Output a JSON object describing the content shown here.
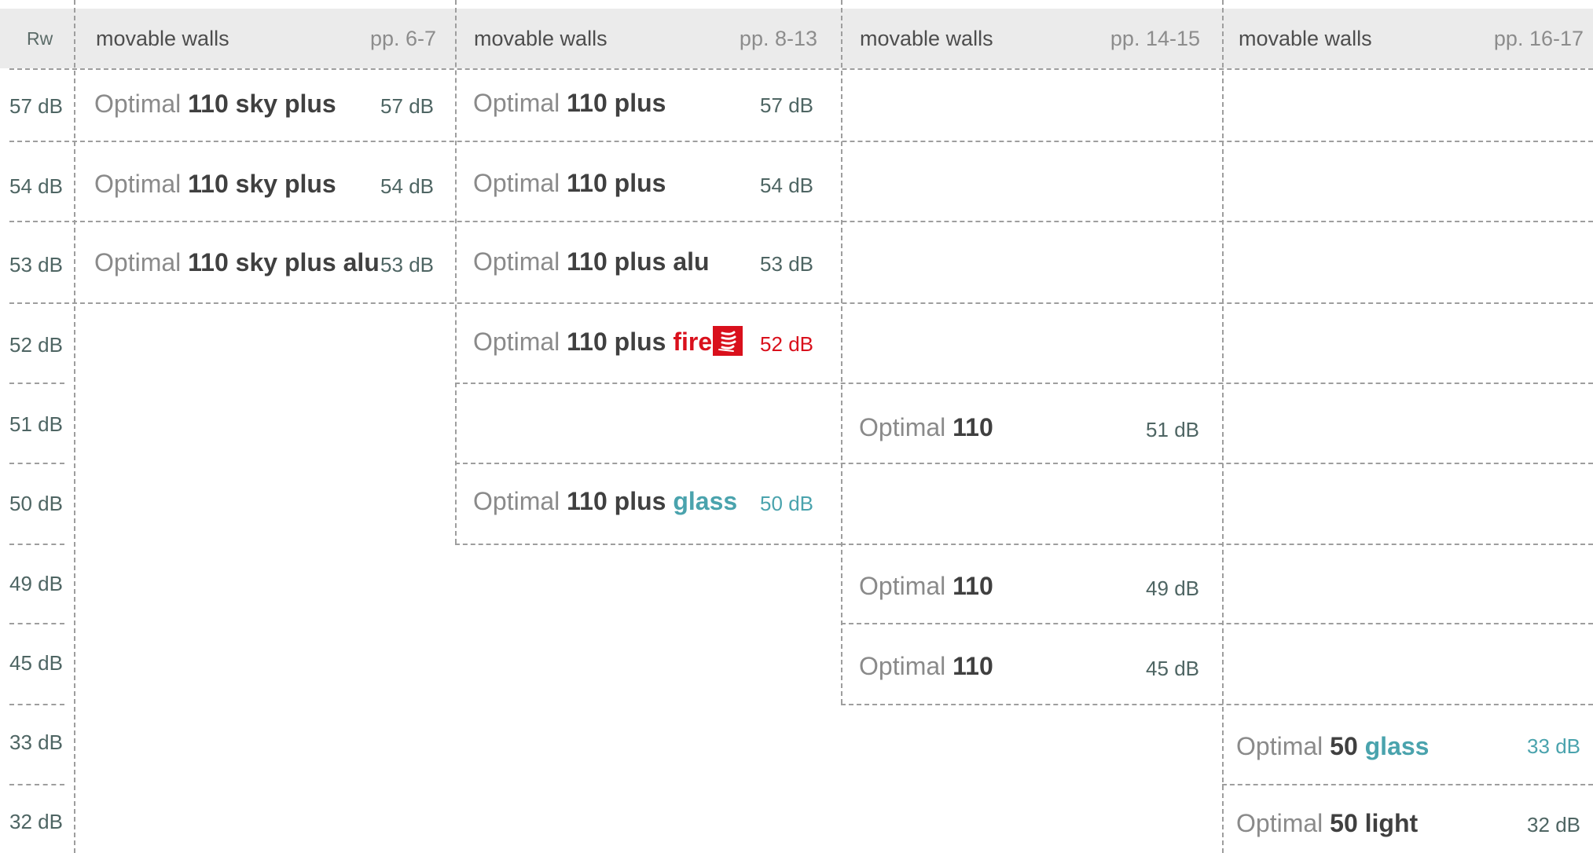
{
  "header": {
    "rw_label": "Rw",
    "columns": [
      {
        "title": "movable walls",
        "pages": "pp. 6-7"
      },
      {
        "title": "movable walls",
        "pages": "pp. 8-13"
      },
      {
        "title": "movable walls",
        "pages": "pp. 14-15"
      },
      {
        "title": "movable walls",
        "pages": "pp. 16-17"
      }
    ]
  },
  "rows": [
    "57 dB",
    "54 dB",
    "53 dB",
    "52 dB",
    "51 dB",
    "50 dB",
    "49 dB",
    "45 dB",
    "33 dB",
    "32 dB"
  ],
  "products": [
    {
      "brand": "Optimal",
      "model": "110 sky plus",
      "accent": "",
      "value": "57 dB"
    },
    {
      "brand": "Optimal",
      "model": "110 sky plus",
      "accent": "",
      "value": "54 dB"
    },
    {
      "brand": "Optimal",
      "model": "110 sky plus alu",
      "accent": "",
      "value": "53 dB"
    },
    {
      "brand": "Optimal",
      "model": "110 plus",
      "accent": "",
      "value": "57 dB"
    },
    {
      "brand": "Optimal",
      "model": "110 plus",
      "accent": "",
      "value": "54 dB"
    },
    {
      "brand": "Optimal",
      "model": "110 plus alu",
      "accent": "",
      "value": "53 dB"
    },
    {
      "brand": "Optimal",
      "model": "110 plus",
      "accent": "fire",
      "value": "52 dB"
    },
    {
      "brand": "Optimal",
      "model": "110 plus",
      "accent": "glass",
      "value": "50 dB"
    },
    {
      "brand": "Optimal",
      "model": "110",
      "accent": "",
      "value": "51 dB"
    },
    {
      "brand": "Optimal",
      "model": "110",
      "accent": "",
      "value": "49 dB"
    },
    {
      "brand": "Optimal",
      "model": "110",
      "accent": "",
      "value": "45 dB"
    },
    {
      "brand": "Optimal",
      "model": "50",
      "accent": "glass",
      "value": "33 dB"
    },
    {
      "brand": "Optimal",
      "model": "50 light",
      "accent": "",
      "value": "32 dB"
    }
  ],
  "icons": {
    "fire": "fire-protection-icon"
  },
  "colors": {
    "header_bg": "#ebebeb",
    "grid": "#9e9e9e",
    "text_dark": "#404040",
    "text_light": "#8a8a8a",
    "fire": "#d9101c",
    "glass": "#4aa3ad",
    "db_value": "#4e6563"
  }
}
